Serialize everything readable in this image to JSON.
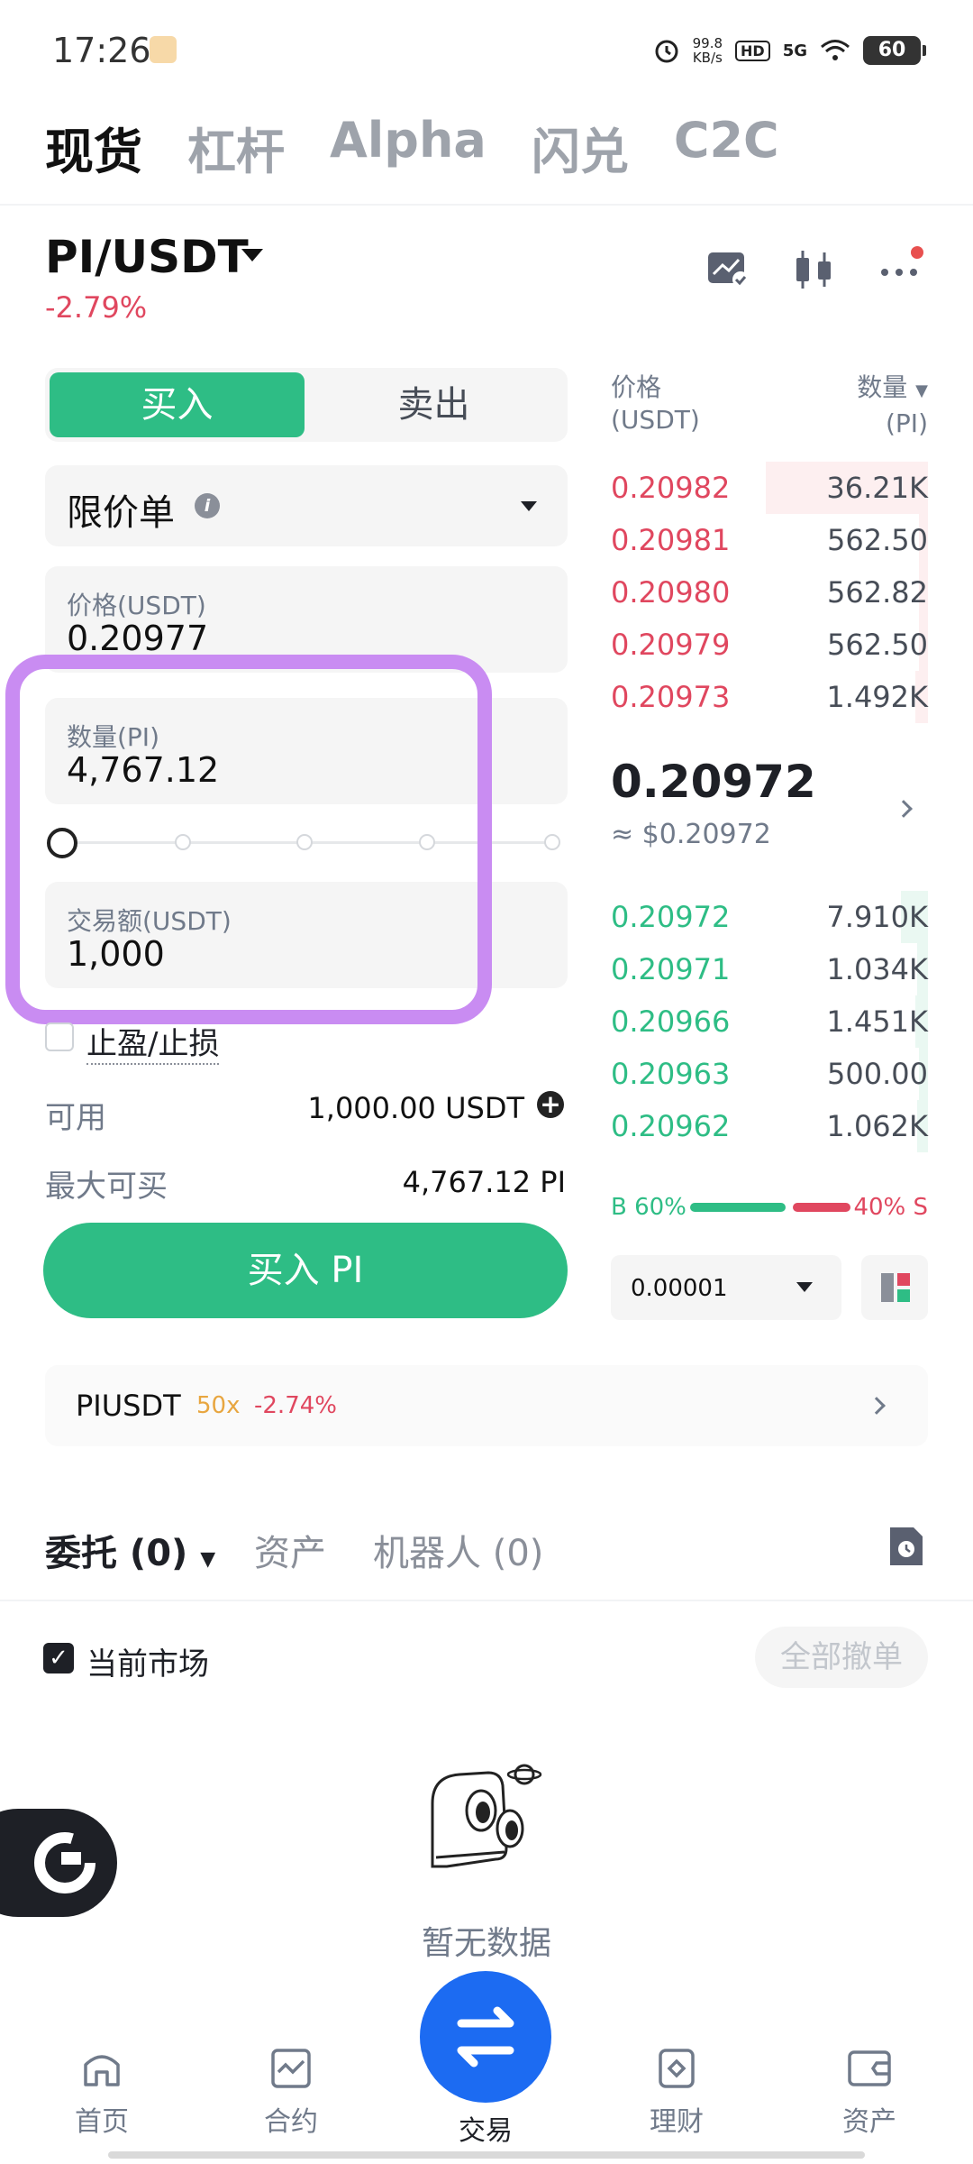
{
  "status": {
    "time": "17:26",
    "net_speed_value": "99.8",
    "net_speed_unit": "KB/s",
    "hd": "HD",
    "signal": "5G",
    "battery": "60"
  },
  "top_tabs": [
    {
      "label": "现货",
      "active": true
    },
    {
      "label": "杠杆",
      "active": false
    },
    {
      "label": "Alpha",
      "active": false
    },
    {
      "label": "闪兑",
      "active": false
    },
    {
      "label": "C2C",
      "active": false
    }
  ],
  "pair": {
    "name": "PI/USDT",
    "change": "-2.79%"
  },
  "order_form": {
    "buy_label": "买入",
    "sell_label": "卖出",
    "order_type": "限价单",
    "info_glyph": "i",
    "price_label": "价格(USDT)",
    "price_value": "0.20977",
    "amount_label": "数量(PI)",
    "amount_value": "4,767.12",
    "total_label": "交易额(USDT)",
    "total_value": "1,000",
    "tpsl_label": "止盈/止损",
    "available_label": "可用",
    "available_value": "1,000.00 USDT",
    "max_buy_label": "最大可买",
    "max_buy_value": "4,767.12 PI",
    "submit_label": "买入 PI",
    "slider_fraction": 0
  },
  "order_book": {
    "price_header": "价格",
    "price_unit": "(USDT)",
    "qty_header": "数量",
    "qty_unit": "(PI)",
    "asks": [
      {
        "price": "0.20982",
        "qty": "36.21K"
      },
      {
        "price": "0.20981",
        "qty": "562.50"
      },
      {
        "price": "0.20980",
        "qty": "562.82"
      },
      {
        "price": "0.20979",
        "qty": "562.50"
      },
      {
        "price": "0.20973",
        "qty": "1.492K"
      }
    ],
    "last_price": "0.20972",
    "last_price_usd": "≈ $0.20972",
    "bids": [
      {
        "price": "0.20972",
        "qty": "7.910K"
      },
      {
        "price": "0.20971",
        "qty": "1.034K"
      },
      {
        "price": "0.20966",
        "qty": "1.451K"
      },
      {
        "price": "0.20963",
        "qty": "500.00"
      },
      {
        "price": "0.20962",
        "qty": "1.062K"
      }
    ],
    "buy_ratio": "B 60%",
    "sell_ratio": "40% S",
    "depth": "0.00001"
  },
  "futures": {
    "name": "PIUSDT",
    "leverage": "50x",
    "change": "-2.74%"
  },
  "orders": {
    "tabs": [
      {
        "label": "委托 (0)",
        "active": true
      },
      {
        "label": "资产",
        "active": false
      },
      {
        "label": "机器人 (0)",
        "active": false
      }
    ],
    "current_market_label": "当前市场",
    "cancel_all_label": "全部撤单",
    "empty_text": "暂无数据"
  },
  "bottom_nav": [
    {
      "label": "首页",
      "icon": "home-icon"
    },
    {
      "label": "合约",
      "icon": "futures-icon"
    },
    {
      "label": "交易",
      "icon": "swap-icon"
    },
    {
      "label": "理财",
      "icon": "earn-icon"
    },
    {
      "label": "资产",
      "icon": "wallet-icon"
    }
  ],
  "colors": {
    "buy": "#2ebd85",
    "sell": "#e0475f",
    "accent": "#1c6bf2",
    "highlight": "#c98cf2"
  }
}
